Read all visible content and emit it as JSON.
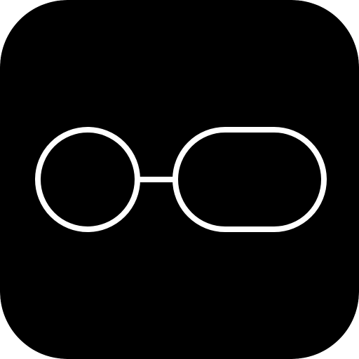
{
  "icon": {
    "name": "glasses-icon",
    "background_color": "#000000",
    "stroke_color": "#ffffff"
  }
}
